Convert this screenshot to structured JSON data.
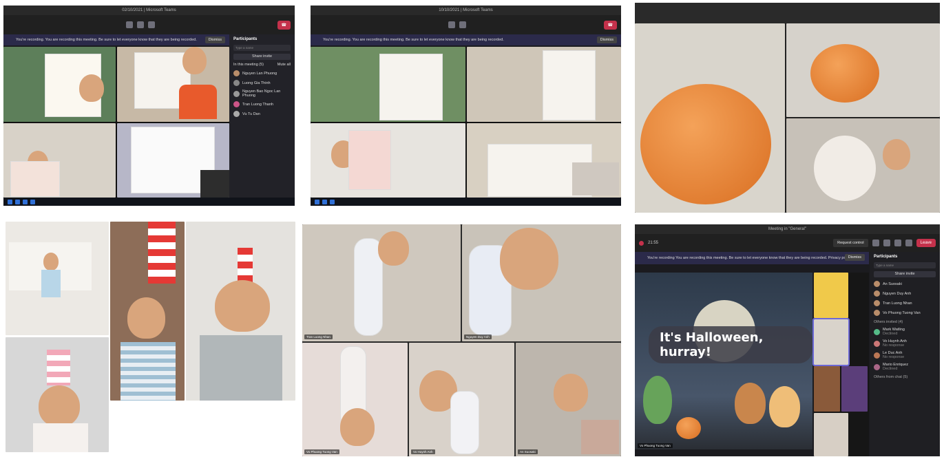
{
  "panel_a": {
    "title": "02/10/2021 | Microsoft Teams",
    "recording_banner": "You're recording. You are recording this meeting. Be sure to let everyone know that they are being recorded.",
    "dismiss_label": "Dismiss",
    "participants": {
      "heading": "Participants",
      "search_placeholder": "Type a name",
      "share_invite": "Share invite",
      "in_meeting_label": "In this meeting (5)",
      "mute_all": "Mute all",
      "people": [
        "Nguyen Lan Phuong",
        "Luong Gia Thinh",
        "Nguyen Bao Ngoc Lan Phuong",
        "Tran Luong Thanh",
        "Vu Tu Dan"
      ]
    }
  },
  "panel_b": {
    "title": "10/10/2021 | Microsoft Teams"
  },
  "panel_f": {
    "window_title": "Meeting in \"General\"",
    "timer": "21:55",
    "request_control": "Request control",
    "leave_label": "Leave",
    "recording_banner": "You're recording  You are recording this meeting. Be sure to let everyone know that they are being recorded. Privacy policy",
    "dismiss_label": "Dismiss",
    "halloween_title": "It's Halloween, hurray!",
    "presenter_name": "Vo Phuong Tuong Van",
    "participants": {
      "heading": "Participants",
      "search_placeholder": "Type a name",
      "share_invite": "Share invite",
      "people": [
        "An Suosaki",
        "Nguyen Duy Anh",
        "Tran Luong Nhan",
        "Vo Phuong Tuong Van"
      ],
      "others_invited": "Others invited (4)",
      "invited": [
        {
          "name": "Mark Watling",
          "status": "Declined"
        },
        {
          "name": "Vo Huynh Anh",
          "status": "No response"
        },
        {
          "name": "Le Duc Anh",
          "status": "No response"
        },
        {
          "name": "Mario Enriquez",
          "status": "Declined"
        }
      ],
      "others_chat": "Others from chat (5)"
    }
  },
  "panel_e": {
    "names": [
      "Tran Luong Nhan",
      "Nguyen Duy Anh",
      "Vo Phuong Tuong Van",
      "Vo Huynh Anh",
      "An Suosaki"
    ]
  },
  "colors": {
    "teams_dark": "#1b1b1f",
    "leave_red": "#c4314b",
    "banner": "#2b2a4a"
  }
}
